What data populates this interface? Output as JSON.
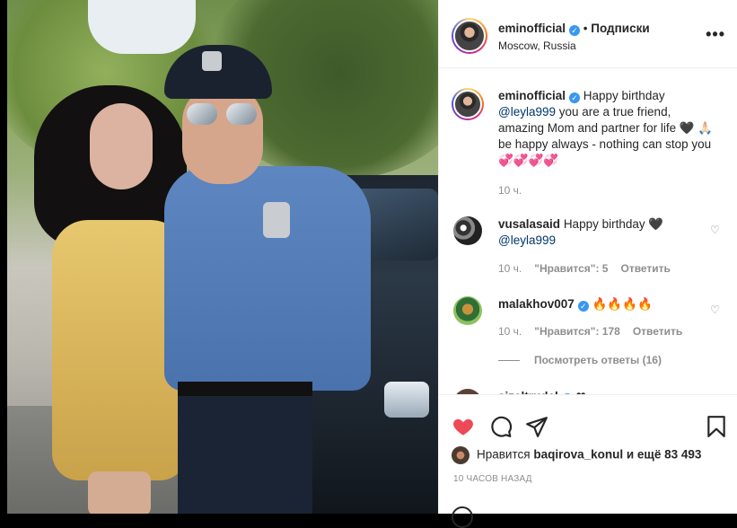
{
  "post": {
    "username": "eminofficial",
    "separator": "•",
    "follow_label": "Подписки",
    "location": "Moscow, Russia",
    "more_label": "•••"
  },
  "caption": {
    "username": "eminofficial",
    "text_before": "Happy birthday ",
    "mention": "@leyla999",
    "text_after": " you are a true friend, amazing Mom and partner for life 🖤 🙏🏻 be happy always - nothing can stop you 💞💞💞💞",
    "time": "10 ч."
  },
  "comments": [
    {
      "username": "vusalasaid",
      "verified": false,
      "text": "Happy birthday 🖤",
      "mention": "@leyla999",
      "time": "10 ч.",
      "likes_label": "\"Нравится\": 5",
      "reply_label": "Ответить"
    },
    {
      "username": "malakhov007",
      "verified": true,
      "text": "🔥🔥🔥🔥",
      "time": "10 ч.",
      "likes_label": "\"Нравится\": 178",
      "reply_label": "Ответить"
    },
    {
      "username": "aizeltrudel",
      "verified": true,
      "text": "❤"
    }
  ],
  "view_replies_label": "Посмотреть ответы (16)",
  "likes": {
    "prefix": "Нравится",
    "user": "baqirova_konul",
    "suffix": " и ещё 83 493"
  },
  "timeago": "10 ЧАСОВ НАЗАД",
  "colors": {
    "like_red": "#ed4956",
    "verified_blue": "#3897f0",
    "muted": "#8e8e8e"
  },
  "icons": [
    "heart-filled-icon",
    "comment-icon",
    "share-icon",
    "bookmark-icon",
    "more-icon",
    "verified-icon",
    "heart-outline-icon"
  ]
}
